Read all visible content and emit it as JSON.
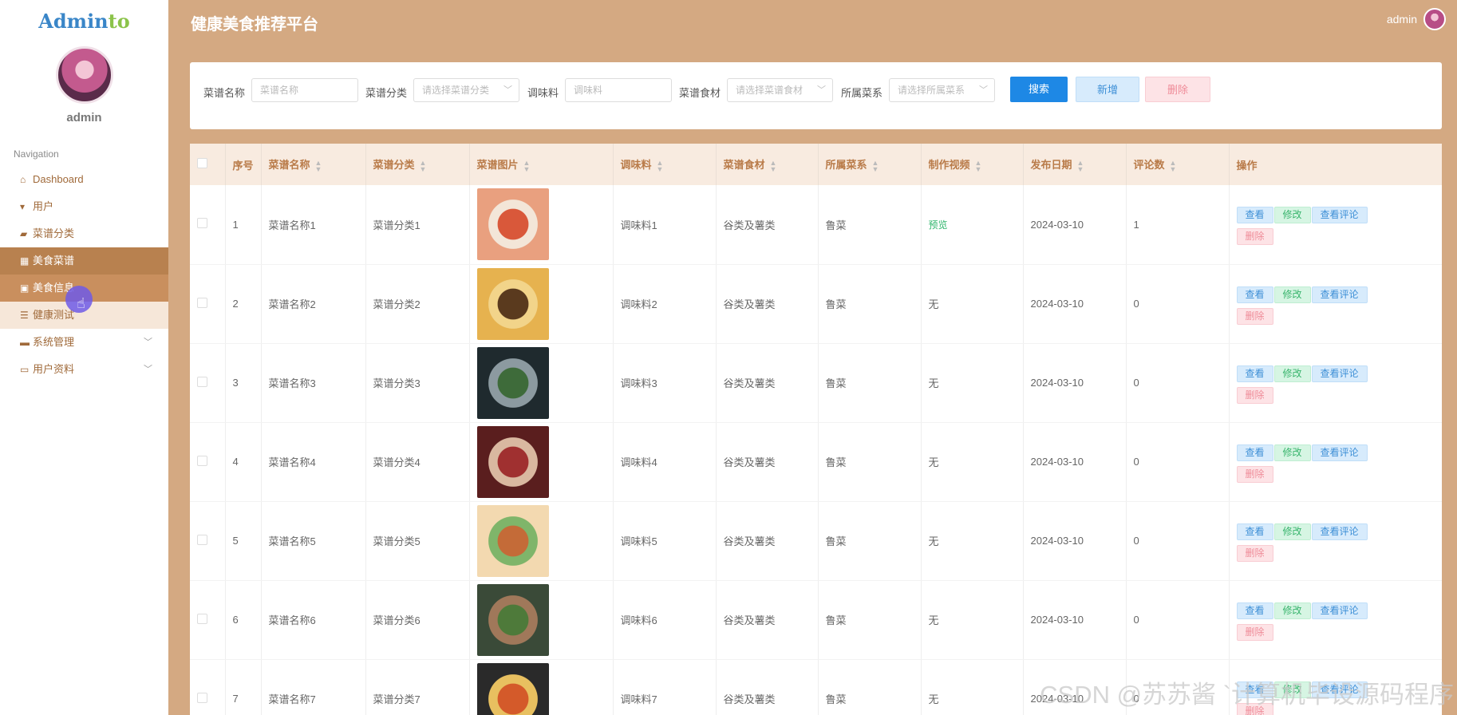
{
  "sidebar": {
    "logo_part1": "Admin",
    "logo_part2": "to",
    "user_name": "admin",
    "nav_title": "Navigation",
    "items": [
      {
        "label": "Dashboard",
        "icon": "home-icon"
      },
      {
        "label": "用户",
        "icon": "user-icon"
      },
      {
        "label": "菜谱分类",
        "icon": "category-icon"
      },
      {
        "label": "美食菜谱",
        "icon": "grid-icon"
      },
      {
        "label": "美食信息",
        "icon": "clipboard-icon"
      },
      {
        "label": "健康测试",
        "icon": "list-icon"
      },
      {
        "label": "系统管理",
        "icon": "message-icon"
      },
      {
        "label": "用户资料",
        "icon": "profile-icon"
      }
    ]
  },
  "header": {
    "title": "健康美食推荐平台",
    "user": "admin"
  },
  "search": {
    "name_label": "菜谱名称",
    "name_placeholder": "菜谱名称",
    "category_label": "菜谱分类",
    "category_placeholder": "请选择菜谱分类",
    "seasoning_label": "调味料",
    "seasoning_placeholder": "调味料",
    "ingredient_label": "菜谱食材",
    "ingredient_placeholder": "请选择菜谱食材",
    "cuisine_label": "所属菜系",
    "cuisine_placeholder": "请选择所属菜系",
    "search_button": "搜索",
    "add_button": "新增",
    "delete_button": "删除"
  },
  "table": {
    "columns": [
      "序号",
      "菜谱名称",
      "菜谱分类",
      "菜谱图片",
      "调味料",
      "菜谱食材",
      "所属菜系",
      "制作视频",
      "发布日期",
      "评论数",
      "操作"
    ],
    "ops": {
      "view": "查看",
      "edit": "修改",
      "comments": "查看评论",
      "delete": "删除"
    },
    "rows": [
      {
        "no": "1",
        "name": "菜谱名称1",
        "category": "菜谱分类1",
        "seasoning": "调味料1",
        "ingredient": "谷类及薯类",
        "cuisine": "鲁菜",
        "video": "预览",
        "date": "2024-03-10",
        "comments": "1"
      },
      {
        "no": "2",
        "name": "菜谱名称2",
        "category": "菜谱分类2",
        "seasoning": "调味料2",
        "ingredient": "谷类及薯类",
        "cuisine": "鲁菜",
        "video": "无",
        "date": "2024-03-10",
        "comments": "0"
      },
      {
        "no": "3",
        "name": "菜谱名称3",
        "category": "菜谱分类3",
        "seasoning": "调味料3",
        "ingredient": "谷类及薯类",
        "cuisine": "鲁菜",
        "video": "无",
        "date": "2024-03-10",
        "comments": "0"
      },
      {
        "no": "4",
        "name": "菜谱名称4",
        "category": "菜谱分类4",
        "seasoning": "调味料4",
        "ingredient": "谷类及薯类",
        "cuisine": "鲁菜",
        "video": "无",
        "date": "2024-03-10",
        "comments": "0"
      },
      {
        "no": "5",
        "name": "菜谱名称5",
        "category": "菜谱分类5",
        "seasoning": "调味料5",
        "ingredient": "谷类及薯类",
        "cuisine": "鲁菜",
        "video": "无",
        "date": "2024-03-10",
        "comments": "0"
      },
      {
        "no": "6",
        "name": "菜谱名称6",
        "category": "菜谱分类6",
        "seasoning": "调味料6",
        "ingredient": "谷类及薯类",
        "cuisine": "鲁菜",
        "video": "无",
        "date": "2024-03-10",
        "comments": "0"
      },
      {
        "no": "7",
        "name": "菜谱名称7",
        "category": "菜谱分类7",
        "seasoning": "调味料7",
        "ingredient": "谷类及薯类",
        "cuisine": "鲁菜",
        "video": "无",
        "date": "2024-03-10",
        "comments": "0"
      }
    ],
    "thumb_colors": [
      [
        "#e9a07f",
        "#d9583a",
        "#f3e6d8"
      ],
      [
        "#e6b24f",
        "#5a3a1e",
        "#f2d48a"
      ],
      [
        "#1f2a2e",
        "#3e6b3a",
        "#8c9aa0"
      ],
      [
        "#5a1e1e",
        "#a03030",
        "#d9b8a0"
      ],
      [
        "#f3d9b0",
        "#c46b38",
        "#7fb56a"
      ],
      [
        "#3a4a38",
        "#4e7a3a",
        "#a0785a"
      ],
      [
        "#2a2a2a",
        "#d45a2a",
        "#e8c060"
      ]
    ]
  },
  "watermark": "CSDN @苏苏酱  `计算机毕设源码程序"
}
